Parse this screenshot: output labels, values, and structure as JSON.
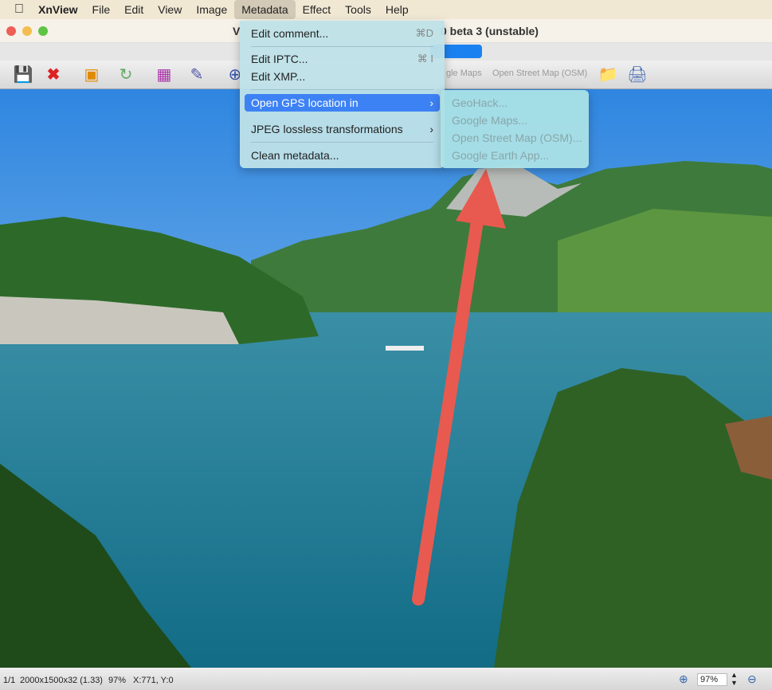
{
  "menubar": {
    "items": [
      "XnView",
      "File",
      "Edit",
      "View",
      "Image",
      "Metadata",
      "Effect",
      "Tools",
      "Help"
    ]
  },
  "window": {
    "title_left": "V",
    "title_right": "0 beta 3 (unstable)"
  },
  "toolbar": {
    "hidden_labels": [
      "gle Maps",
      "Open Street Map (OSM)"
    ]
  },
  "metadata_menu": {
    "items": [
      {
        "label": "Edit comment...",
        "shortcut": "⌘D"
      },
      {
        "label": "Edit IPTC...",
        "shortcut": "⌘ I"
      },
      {
        "label": "Edit XMP...",
        "shortcut": ""
      },
      {
        "label": "Open GPS location in",
        "submenu": true
      },
      {
        "label": "JPEG lossless transformations",
        "submenu": true
      },
      {
        "label": "Clean metadata..."
      }
    ]
  },
  "gps_submenu": {
    "items": [
      "GeoHack...",
      "Google Maps...",
      "Open Street Map (OSM)...",
      "Google Earth App..."
    ]
  },
  "status": {
    "page": "1/1",
    "dimensions": "2000x1500x32 (1.33)",
    "zoom": "97%",
    "coords": "X:771, Y:0",
    "zoom_field": "97%"
  },
  "colors": {
    "highlight": "#3d82f5",
    "arrow": "#e85a4f"
  }
}
